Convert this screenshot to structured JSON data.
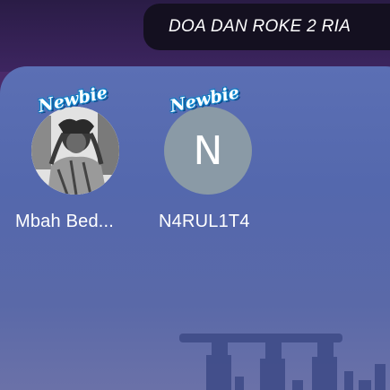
{
  "room": {
    "title": "DOA DAN ROKE 2 RIA"
  },
  "seats": [
    {
      "badge": "Newbie",
      "name": "Mbah Bed...",
      "avatar_type": "photo",
      "initial": ""
    },
    {
      "badge": "Newbie",
      "name": "N4RUL1T4",
      "avatar_type": "initial",
      "initial": "N"
    }
  ],
  "colors": {
    "accent_badge": "#1aa6e8",
    "title_pill": "#141020",
    "panel": "#5b6fb4",
    "initial_avatar": "#8a9aa6"
  },
  "icons": {
    "skyline": "city-skyline-background",
    "avatar_photo": "user-photo-icon"
  }
}
